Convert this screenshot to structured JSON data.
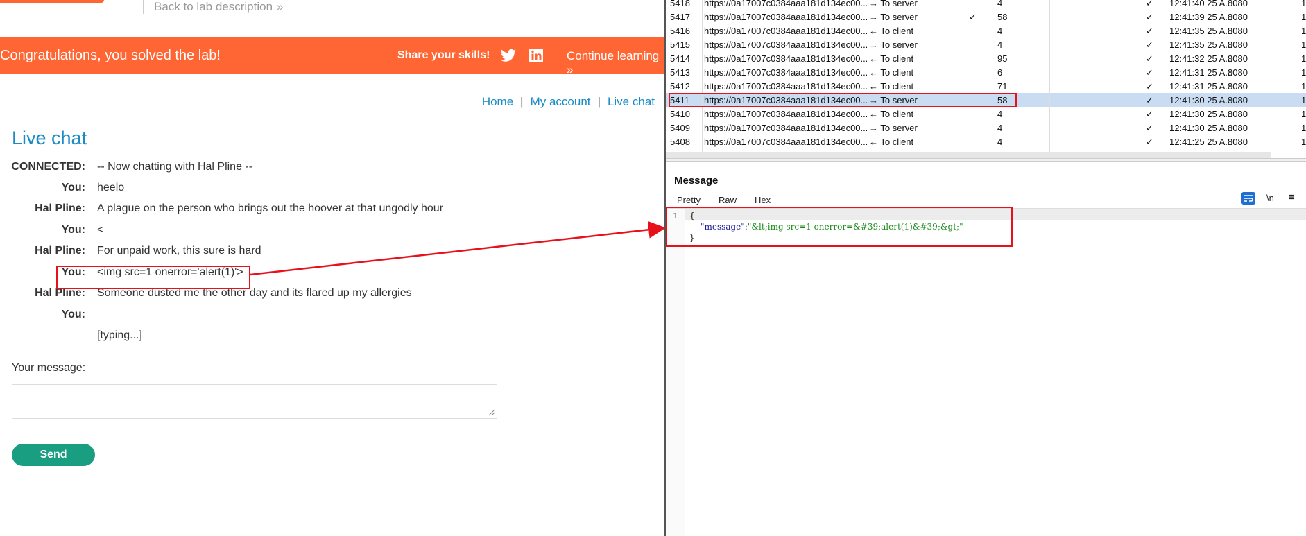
{
  "lab": {
    "back_link": "Back to lab description",
    "banner": {
      "title": "Congratulations, you solved the lab!",
      "share": "Share your skills!",
      "continue": "Continue learning"
    },
    "nav": [
      "Home",
      "My account",
      "Live chat"
    ],
    "title": "Live chat",
    "chat": [
      {
        "who": "CONNECTED:",
        "msg": "-- Now chatting with Hal Pline --"
      },
      {
        "who": "You:",
        "msg": "heelo"
      },
      {
        "who": "Hal Pline:",
        "msg": "A plague on the person who brings out the hoover at that ungodly hour"
      },
      {
        "who": "You:",
        "msg": "<"
      },
      {
        "who": "Hal Pline:",
        "msg": "For unpaid work, this sure is hard"
      },
      {
        "who": "You:",
        "msg": "<img src=1 onerror='alert(1)'>"
      },
      {
        "who": "Hal Pline:",
        "msg": "Someone dusted me the other day and its flared up my allergies"
      },
      {
        "who": "You:",
        "msg": ""
      },
      {
        "who": "",
        "msg": "[typing...]"
      }
    ],
    "your_message_label": "Your message:",
    "send_label": "Send",
    "colors": {
      "accent": "#ff6633",
      "link": "#1a8bc3",
      "send": "#1a9e81",
      "highlight": "#e8111a"
    }
  },
  "proxy": {
    "rows": [
      {
        "id": "5418",
        "url": "https://0a17007c0384aaa181d134ec00...",
        "dir": "→ To server",
        "edited": "",
        "len": "4",
        "ws": "✓",
        "time": "12:41:40 25 A...",
        "port": "8080",
        "extra": "1"
      },
      {
        "id": "5417",
        "url": "https://0a17007c0384aaa181d134ec00...",
        "dir": "→ To server",
        "edited": "✓",
        "len": "58",
        "ws": "✓",
        "time": "12:41:39 25 A...",
        "port": "8080",
        "extra": "1"
      },
      {
        "id": "5416",
        "url": "https://0a17007c0384aaa181d134ec00...",
        "dir": "← To client",
        "edited": "",
        "len": "4",
        "ws": "✓",
        "time": "12:41:35 25 A...",
        "port": "8080",
        "extra": "1"
      },
      {
        "id": "5415",
        "url": "https://0a17007c0384aaa181d134ec00...",
        "dir": "→ To server",
        "edited": "",
        "len": "4",
        "ws": "✓",
        "time": "12:41:35 25 A...",
        "port": "8080",
        "extra": "1"
      },
      {
        "id": "5414",
        "url": "https://0a17007c0384aaa181d134ec00...",
        "dir": "← To client",
        "edited": "",
        "len": "95",
        "ws": "✓",
        "time": "12:41:32 25 A...",
        "port": "8080",
        "extra": "1"
      },
      {
        "id": "5413",
        "url": "https://0a17007c0384aaa181d134ec00...",
        "dir": "← To client",
        "edited": "",
        "len": "6",
        "ws": "✓",
        "time": "12:41:31 25 A...",
        "port": "8080",
        "extra": "1"
      },
      {
        "id": "5412",
        "url": "https://0a17007c0384aaa181d134ec00...",
        "dir": "← To client",
        "edited": "",
        "len": "71",
        "ws": "✓",
        "time": "12:41:31 25 A...",
        "port": "8080",
        "extra": "1"
      },
      {
        "id": "5411",
        "url": "https://0a17007c0384aaa181d134ec00...",
        "dir": "→ To server",
        "edited": "",
        "len": "58",
        "ws": "✓",
        "time": "12:41:30 25 A...",
        "port": "8080",
        "extra": "1",
        "selected": true
      },
      {
        "id": "5410",
        "url": "https://0a17007c0384aaa181d134ec00...",
        "dir": "← To client",
        "edited": "",
        "len": "4",
        "ws": "✓",
        "time": "12:41:30 25 A...",
        "port": "8080",
        "extra": "1"
      },
      {
        "id": "5409",
        "url": "https://0a17007c0384aaa181d134ec00...",
        "dir": "→ To server",
        "edited": "",
        "len": "4",
        "ws": "✓",
        "time": "12:41:30 25 A...",
        "port": "8080",
        "extra": "1"
      },
      {
        "id": "5408",
        "url": "https://0a17007c0384aaa181d134ec00...",
        "dir": "← To client",
        "edited": "",
        "len": "4",
        "ws": "✓",
        "time": "12:41:25 25 A...",
        "port": "8080",
        "extra": "1"
      }
    ],
    "message_heading": "Message",
    "tabs": [
      "Pretty",
      "Raw",
      "Hex"
    ],
    "newline_label": "\\n",
    "menu_glyph": "≡",
    "editor": {
      "line_numbers": [
        "1"
      ],
      "open_brace": "{",
      "key": "\"message\"",
      "colon": ":",
      "value": "\"&lt;img src=1 onerror=&#39;alert(1)&#39;&gt;\"",
      "close_brace": "}"
    }
  }
}
